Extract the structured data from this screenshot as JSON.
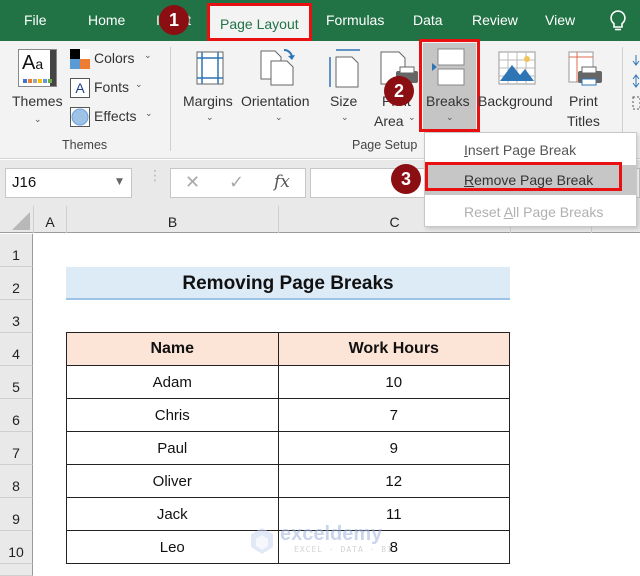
{
  "menu": {
    "tabs": [
      "File",
      "Home",
      "Insert",
      "Page Layout",
      "Formulas",
      "Data",
      "Review",
      "View"
    ],
    "active_tab": "Page Layout",
    "tell_me_icon": "lightbulb-icon"
  },
  "ribbon": {
    "themes_group": {
      "themes_label": "Themes",
      "colors_label": "Colors",
      "fonts_label": "Fonts",
      "effects_label": "Effects",
      "group_label": "Themes"
    },
    "page_setup_group": {
      "margins_label": "Margins",
      "orientation_label": "Orientation",
      "size_label": "Size",
      "print_area_label_1": "Print",
      "print_area_label_2": "Area",
      "breaks_label": "Breaks",
      "background_label": "Background",
      "print_titles_label_1": "Print",
      "print_titles_label_2": "Titles",
      "group_label": "Page Setup"
    }
  },
  "breaks_menu": {
    "items": [
      {
        "label": "Insert Page Break",
        "accel": "I",
        "enabled": true
      },
      {
        "label": "Remove Page Break",
        "accel": "R",
        "enabled": true,
        "highlighted": true
      },
      {
        "label": "Reset All Page Breaks",
        "accel": "A",
        "enabled": false
      }
    ]
  },
  "formula_bar": {
    "name_box": "J16",
    "cancel_icon": "✕",
    "enter_icon": "✓",
    "fx_label": "fx",
    "formula_value": ""
  },
  "grid": {
    "columns": [
      "A",
      "B",
      "C"
    ],
    "rows": [
      "1",
      "2",
      "3",
      "4",
      "5",
      "6",
      "7",
      "8",
      "9",
      "10"
    ]
  },
  "sheet": {
    "title": "Removing Page Breaks",
    "table": {
      "headers": [
        "Name",
        "Work Hours"
      ],
      "rows": [
        [
          "Adam",
          "10"
        ],
        [
          "Chris",
          "7"
        ],
        [
          "Paul",
          "9"
        ],
        [
          "Oliver",
          "12"
        ],
        [
          "Jack",
          "11"
        ],
        [
          "Leo",
          "8"
        ]
      ]
    }
  },
  "annotations": {
    "step1": "1",
    "step2": "2",
    "step3": "3"
  },
  "watermark": {
    "brand": "exceldemy",
    "tagline": "EXCEL · DATA · BI"
  },
  "colors": {
    "excel_green": "#217346",
    "highlight_red": "#e81010",
    "badge": "#8b0e12",
    "title_fill": "#ddebf7",
    "header_fill": "#fce4d6"
  }
}
